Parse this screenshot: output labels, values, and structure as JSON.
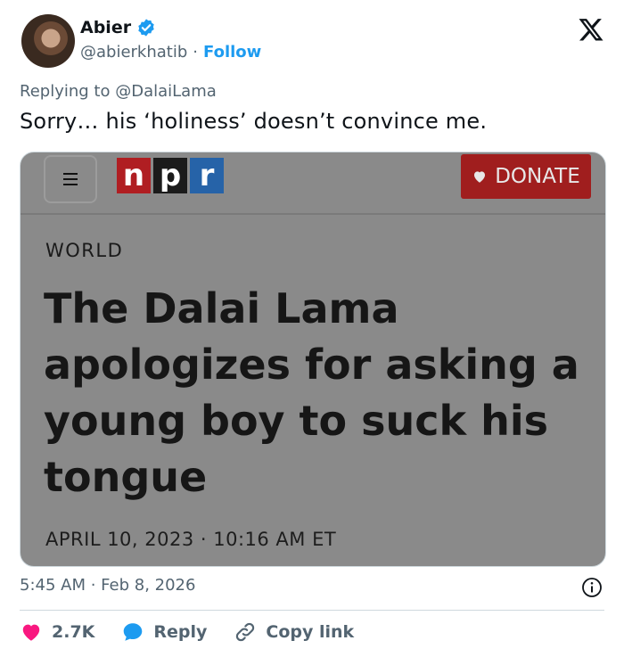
{
  "author": {
    "name": "Abier",
    "handle": "@abierkhatib",
    "separator": "·",
    "follow_label": "Follow"
  },
  "reply_context": {
    "prefix": "Replying to",
    "mention": "@DalaiLama"
  },
  "tweet_text": "Sorry… his ‘holiness’ doesn’t convince me.",
  "card": {
    "logo_letters": [
      "n",
      "p",
      "r"
    ],
    "donate_label": "DONATE",
    "section": "WORLD",
    "headline": "The Dalai Lama apologizes for asking a young boy to suck his tongue",
    "dateline": "APRIL 10, 2023 · 10:16 AM ET"
  },
  "timestamp": "5:45 AM · Feb 8, 2026",
  "actions": {
    "likes": "2.7K",
    "reply_label": "Reply",
    "copy_link_label": "Copy link"
  },
  "colors": {
    "accent": "#1d9bf0",
    "like": "#f91880",
    "npr_red": "#b01e22",
    "npr_blue": "#2663a8"
  },
  "icons": [
    "verified-badge-icon",
    "x-logo-icon",
    "menu-icon",
    "heart-icon",
    "info-icon",
    "like-icon",
    "reply-icon",
    "link-icon"
  ]
}
